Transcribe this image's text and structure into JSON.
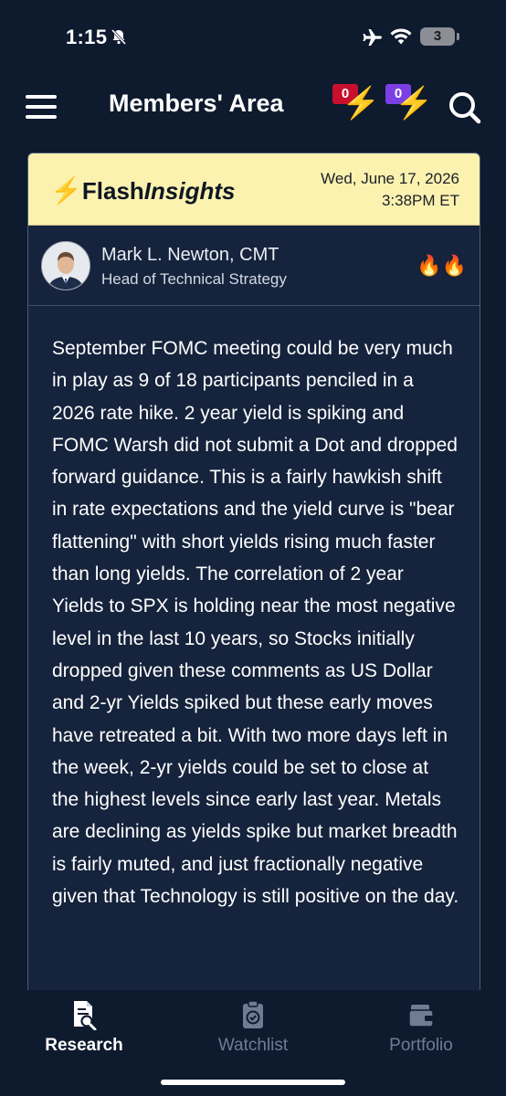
{
  "status_bar": {
    "time": "1:15",
    "battery": "3"
  },
  "header": {
    "title": "Members' Area",
    "flash_red_count": "0",
    "flash_purple_count": "0"
  },
  "card": {
    "brand_prefix": "Flash",
    "brand_suffix": "Insights",
    "date": "Wed, June 17, 2026",
    "time": "3:38PM ET",
    "author_name": "Mark L. Newton, CMT",
    "author_role": "Head of Technical Strategy",
    "reactions": "🔥🔥",
    "body": "September FOMC meeting could be very much in play as 9 of 18 participants penciled in a 2026 rate hike. 2 year yield is spiking and FOMC Warsh did not submit a Dot and dropped forward guidance. This is a fairly hawkish shift in rate expectations and the yield curve is \"bear flattening\" with short yields rising much faster than long yields. The correlation of 2 year Yields to SPX is holding near the most negative level in the last 10 years, so Stocks initially dropped given these comments as US Dollar and 2-yr Yields spiked but these early moves have retreated a bit. With two more days left in the week, 2-yr yields could be set to close at the highest levels since early last year. Metals are declining as yields spike but market breadth is fairly muted, and just fractionally negative given that Technology is still positive on the day."
  },
  "tabs": [
    {
      "label": "Research",
      "icon": "research-icon",
      "active": true
    },
    {
      "label": "Watchlist",
      "icon": "watchlist-icon",
      "active": false
    },
    {
      "label": "Portfolio",
      "icon": "portfolio-icon",
      "active": false
    }
  ],
  "colors": {
    "background": "#0e1a2e",
    "card_header": "#fbf2b0",
    "badge_red": "#c8102e",
    "badge_purple": "#7b3fe4",
    "bolt": "#f2b705"
  }
}
